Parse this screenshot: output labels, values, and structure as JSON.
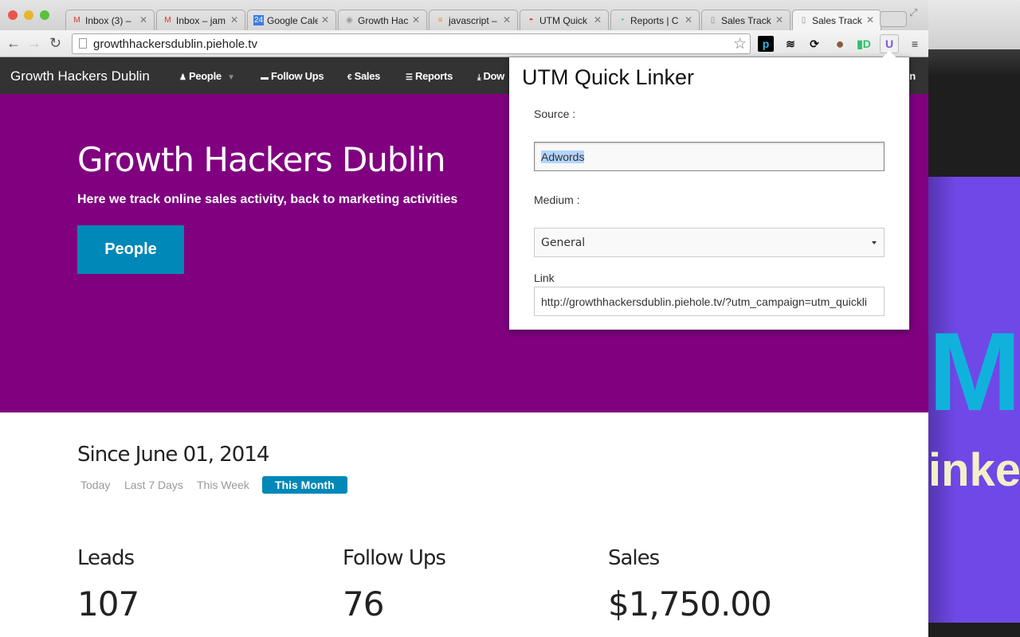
{
  "browser": {
    "tabs": [
      {
        "label": "Inbox (3) –",
        "icon": "gmail-icon"
      },
      {
        "label": "Inbox – jam",
        "icon": "gmail-icon"
      },
      {
        "label": "Google Cale",
        "icon": "calendar-icon"
      },
      {
        "label": "Growth Hac",
        "icon": "globe-icon"
      },
      {
        "label": "javascript –",
        "icon": "stackoverflow-icon"
      },
      {
        "label": "UTM Quick",
        "icon": "chrome-store-icon"
      },
      {
        "label": "Reports | C",
        "icon": "analytics-icon"
      },
      {
        "label": "Sales Track",
        "icon": "page-icon"
      },
      {
        "label": "Sales Track",
        "icon": "page-icon",
        "active": true
      }
    ],
    "url": "growthhackersdublin.piehole.tv"
  },
  "site": {
    "brand": "Growth Hackers Dublin",
    "nav": [
      {
        "label": "People",
        "icon": "user-icon"
      },
      {
        "label": "Follow Ups",
        "icon": "comment-icon"
      },
      {
        "label": "Sales",
        "icon": "euro-icon"
      },
      {
        "label": "Reports",
        "icon": "bars-icon"
      },
      {
        "label": "Dow",
        "icon": "download-icon"
      }
    ],
    "nav_right": "In",
    "hero": {
      "title": "Growth Hackers Dublin",
      "subtitle": "Here we track online sales activity, back to marketing activities",
      "button": "People"
    },
    "since": "Since June 01, 2014",
    "ranges": [
      "Today",
      "Last 7 Days",
      "This Week",
      "This Month"
    ],
    "active_range": "This Month",
    "stats": [
      {
        "label": "Leads",
        "value": "107"
      },
      {
        "label": "Follow Ups",
        "value": "76"
      },
      {
        "label": "Sales",
        "value": "$1,750.00"
      }
    ]
  },
  "popup": {
    "title": "UTM Quick Linker",
    "source_label": "Source :",
    "source_value": "Adwords",
    "medium_label": "Medium :",
    "medium_value": "General",
    "link_label": "Link",
    "link_value": "http://growthhackersdublin.piehole.tv/?utm_campaign=utm_quickli"
  },
  "background_window": {
    "text_big": "M",
    "text_small": "inke"
  },
  "colors": {
    "hero": "#800080",
    "accent": "#0088b8",
    "navbar": "#333333",
    "extension": "#7048e8"
  }
}
